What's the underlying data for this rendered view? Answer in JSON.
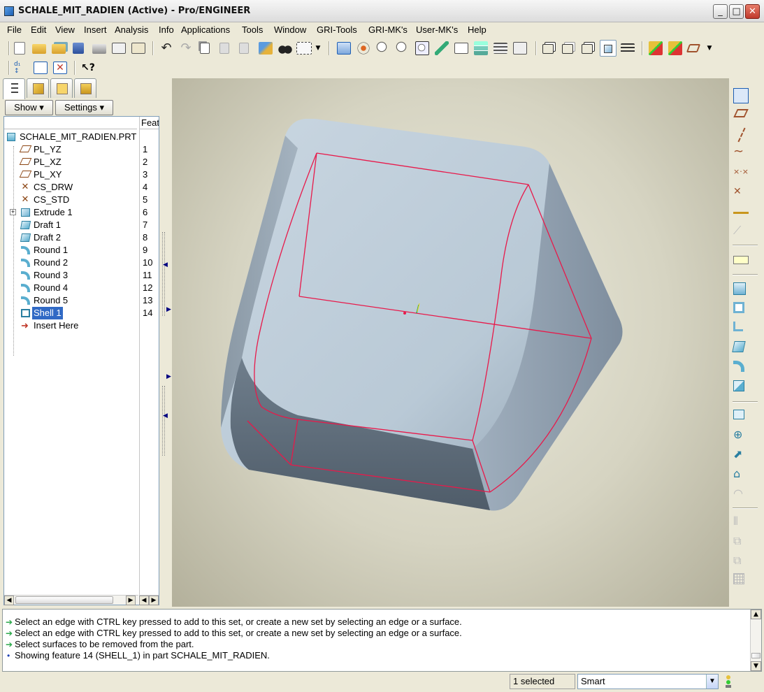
{
  "window": {
    "title": "SCHALE_MIT_RADIEN (Active) - Pro/ENGINEER",
    "minimize": "_",
    "maximize": "□",
    "close": "✕"
  },
  "menu": [
    "File",
    "Edit",
    "View",
    "Insert",
    "Analysis",
    "Info",
    "Applications",
    "Tools",
    "Window",
    "GRI-Tools",
    "GRI-MK's",
    "User-MK's",
    "Help"
  ],
  "toolbar_icons": [
    "new-file-icon",
    "open-file-icon",
    "open-session-icon",
    "save-icon",
    "print-icon",
    "send-mail-icon",
    "send-mail-attach-icon",
    "undo-icon",
    "redo-icon",
    "copy-icon",
    "paste-icon",
    "paste-special-icon",
    "regenerate-icon",
    "find-icon",
    "selection-box-icon",
    "selection-dropdown-icon",
    "repaint-icon",
    "spin-center-icon",
    "zoom-in-icon",
    "zoom-out-icon",
    "refit-icon",
    "reorient-icon",
    "saved-views-icon",
    "layers-icon",
    "view-manager-icon",
    "wireframe-icon",
    "hidden-line-icon",
    "no-hidden-icon",
    "shading-icon",
    "model-tree-toggle-icon",
    "datum-planes-display-icon",
    "datum-axes-display-icon",
    "datum-points-dropdown-icon"
  ],
  "toolbar2_icons": [
    "regen-info-icon",
    "model-display-icon",
    "close-window-icon",
    "context-help-icon"
  ],
  "left_panel": {
    "tabs": [
      "model-tree-tab",
      "layer-tree-tab",
      "favorites-tab",
      "connections-tab"
    ],
    "show_button": "Show",
    "settings_button": "Settings",
    "feat_header": "Feat",
    "tree": [
      {
        "label": "SCHALE_MIT_RADIEN.PRT",
        "num": "",
        "icon": "part-icon"
      },
      {
        "label": "PL_YZ",
        "num": "1",
        "icon": "datum-plane-icon"
      },
      {
        "label": "PL_XZ",
        "num": "2",
        "icon": "datum-plane-icon"
      },
      {
        "label": "PL_XY",
        "num": "3",
        "icon": "datum-plane-icon"
      },
      {
        "label": "CS_DRW",
        "num": "4",
        "icon": "coord-system-icon"
      },
      {
        "label": "CS_STD",
        "num": "5",
        "icon": "coord-system-icon"
      },
      {
        "label": "Extrude 1",
        "num": "6",
        "icon": "extrude-icon"
      },
      {
        "label": "Draft 1",
        "num": "7",
        "icon": "draft-icon"
      },
      {
        "label": "Draft 2",
        "num": "8",
        "icon": "draft-icon"
      },
      {
        "label": "Round 1",
        "num": "9",
        "icon": "round-icon"
      },
      {
        "label": "Round 2",
        "num": "10",
        "icon": "round-icon"
      },
      {
        "label": "Round 3",
        "num": "11",
        "icon": "round-icon"
      },
      {
        "label": "Round 4",
        "num": "12",
        "icon": "round-icon"
      },
      {
        "label": "Round 5",
        "num": "13",
        "icon": "round-icon"
      },
      {
        "label": "Shell 1",
        "num": "14",
        "icon": "shell-icon"
      },
      {
        "label": "Insert Here",
        "num": "",
        "icon": "insert-here-arrow-icon"
      }
    ]
  },
  "right_toolbar": [
    "datum-curve-sketch-icon",
    "datum-plane-tool-icon",
    "datum-axis-tool-icon",
    "datum-curve-tool-icon",
    "datum-point-tool-icon",
    "coord-sys-tool-icon",
    "analysis-feature-icon",
    "cosmetic-feature-icon",
    "annotation-icon",
    "hole-tool-icon",
    "shell-tool-icon",
    "rib-tool-icon",
    "draft-tool-icon",
    "round-tool-icon",
    "chamfer-tool-icon",
    "extrude-tool-icon",
    "revolve-tool-icon",
    "sweep-tool-icon",
    "blend-tool-icon",
    "boundary-blend-icon",
    "mirror-tool-icon",
    "merge-tool-icon",
    "trim-tool-icon",
    "pattern-tool-icon"
  ],
  "messages": [
    {
      "icon": "prompt-arrow-icon",
      "text": "Select an edge with CTRL key pressed to add to this set, or create a new set by selecting an edge or a surface."
    },
    {
      "icon": "prompt-arrow-icon",
      "text": "Select an edge with CTRL key pressed to add to this set, or create a new set by selecting an edge or a surface."
    },
    {
      "icon": "prompt-arrow-icon",
      "text": "Select surfaces to be removed from the part."
    },
    {
      "icon": "info-bullet-icon",
      "text": "Showing feature 14 (SHELL_1) in part SCHALE_MIT_RADIEN."
    }
  ],
  "status": {
    "selected": "1 selected",
    "filter": "Smart"
  },
  "colors": {
    "edge_highlight": "#e8194a",
    "model_surface": "#a9b8c5",
    "selection": "#316ac5"
  }
}
